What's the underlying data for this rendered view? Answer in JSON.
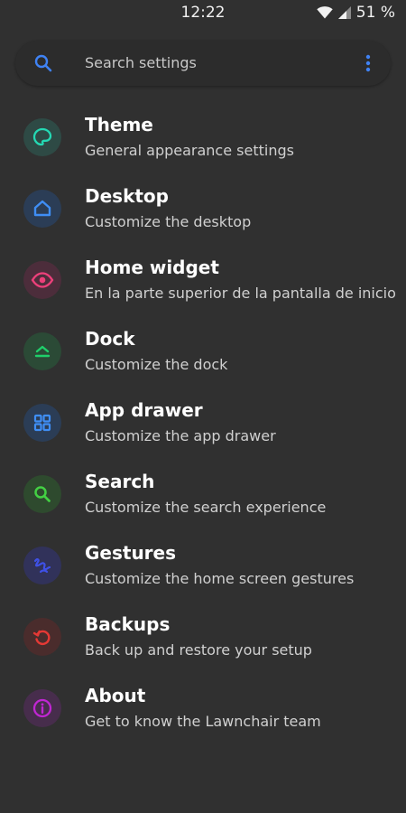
{
  "status_bar": {
    "time": "12:22",
    "battery": "51 %",
    "icons": [
      "wifi-icon",
      "cellular-signal-icon"
    ]
  },
  "search": {
    "placeholder": "Search settings",
    "icon": "search-icon",
    "menu_icon": "more-vert-icon",
    "accent": "#3f82f4"
  },
  "items": [
    {
      "title": "Theme",
      "subtitle": "General appearance settings",
      "icon": "palette-icon",
      "color": "#24d9b4",
      "bg": "#2e4a45"
    },
    {
      "title": "Desktop",
      "subtitle": "Customize the desktop",
      "icon": "home-icon",
      "color": "#3f8ef5",
      "bg": "#2b3d56"
    },
    {
      "title": "Home widget",
      "subtitle": "En la parte superior de la pantalla de inicio",
      "icon": "eye-icon",
      "color": "#ec407a",
      "bg": "#4c2d3b"
    },
    {
      "title": "Dock",
      "subtitle": "Customize the dock",
      "icon": "dock-icon",
      "color": "#1fcf6a",
      "bg": "#2b4a36"
    },
    {
      "title": "App drawer",
      "subtitle": "Customize the app drawer",
      "icon": "grid-icon",
      "color": "#3f8ef5",
      "bg": "#2b3d56"
    },
    {
      "title": "Search",
      "subtitle": "Customize the search experience",
      "icon": "search-icon",
      "color": "#43d043",
      "bg": "#2e4a2e"
    },
    {
      "title": "Gestures",
      "subtitle": "Customize the home screen gestures",
      "icon": "gesture-icon",
      "color": "#3f51e8",
      "bg": "#31325a"
    },
    {
      "title": "Backups",
      "subtitle": "Back up and restore your setup",
      "icon": "restore-icon",
      "color": "#e53935",
      "bg": "#4a2c2c"
    },
    {
      "title": "About",
      "subtitle": "Get to know the Lawnchair team",
      "icon": "info-icon",
      "color": "#c026d3",
      "bg": "#472d4c"
    }
  ]
}
